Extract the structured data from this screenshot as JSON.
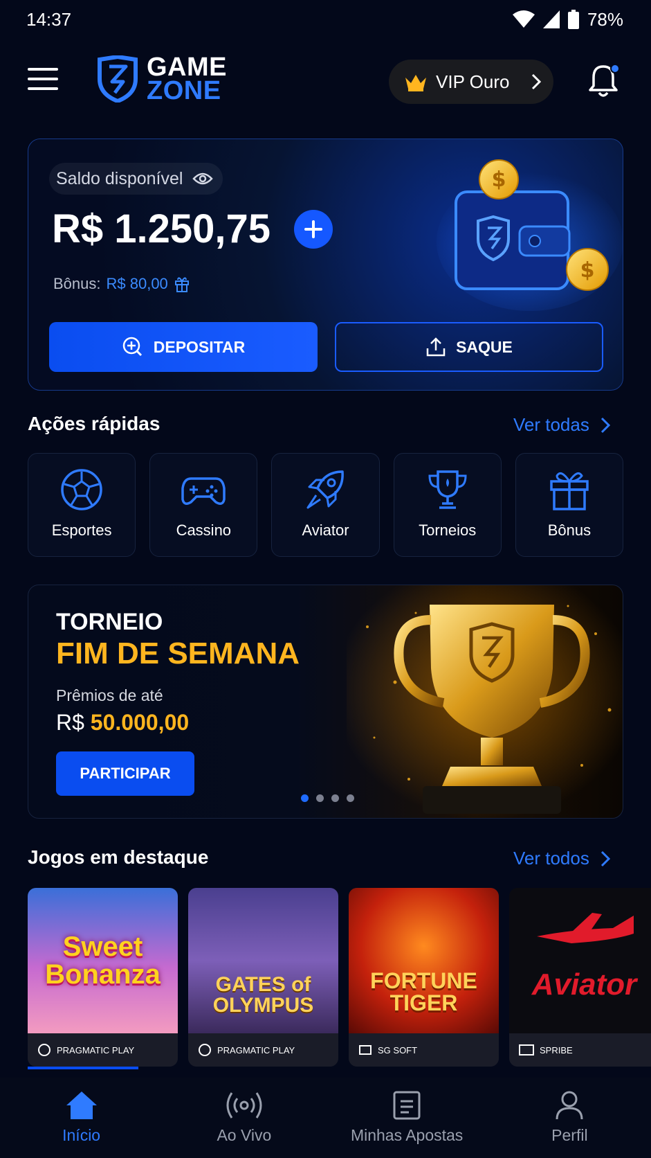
{
  "status_bar": {
    "time": "14:37",
    "battery": "78%"
  },
  "header": {
    "logo_line1": "GAME",
    "logo_line2": "ZONE",
    "vip_label": "VIP Ouro"
  },
  "balance": {
    "label": "Saldo disponível",
    "amount": "R$ 1.250,75",
    "bonus_label": "Bônus:",
    "bonus_value": "R$ 80,00",
    "deposit_label": "DEPOSITAR",
    "withdraw_label": "SAQUE"
  },
  "quick_actions": {
    "title": "Ações rápidas",
    "see_all": "Ver todas",
    "items": [
      {
        "label": "Esportes",
        "icon": "soccer-ball-icon"
      },
      {
        "label": "Cassino",
        "icon": "gamepad-icon"
      },
      {
        "label": "Aviator",
        "icon": "rocket-icon"
      },
      {
        "label": "Torneios",
        "icon": "trophy-icon"
      },
      {
        "label": "Bônus",
        "icon": "gift-icon"
      }
    ]
  },
  "banner": {
    "line1": "TORNEIO",
    "line2": "FIM DE SEMANA",
    "prize_intro": "Prêmios de até",
    "prize_currency": "R$",
    "prize_value": "50.000,00",
    "cta": "PARTICIPAR",
    "slides": 4,
    "active_slide": 1
  },
  "featured": {
    "title": "Jogos em destaque",
    "see_all": "Ver todos",
    "games": [
      {
        "title_line1": "Sweet",
        "title_line2": "Bonanza",
        "provider": "PRAGMATIC PLAY"
      },
      {
        "title_line1": "GATES of",
        "title_line2": "OLYMPUS",
        "provider": "PRAGMATIC PLAY"
      },
      {
        "title_line1": "FORTUNE",
        "title_line2": "TIGER",
        "provider": "SG SOFT"
      },
      {
        "title_line1": "",
        "title_line2": "Aviator",
        "provider": "SPRIBE"
      }
    ]
  },
  "nav": {
    "items": [
      {
        "label": "Início",
        "icon": "home-icon"
      },
      {
        "label": "Ao Vivo",
        "icon": "broadcast-icon"
      },
      {
        "label": "Minhas Apostas",
        "icon": "ticket-icon"
      },
      {
        "label": "Perfil",
        "icon": "user-icon"
      }
    ]
  },
  "colors": {
    "accent": "#2f7bff",
    "gold": "#ffb51f",
    "background": "#03081a"
  }
}
